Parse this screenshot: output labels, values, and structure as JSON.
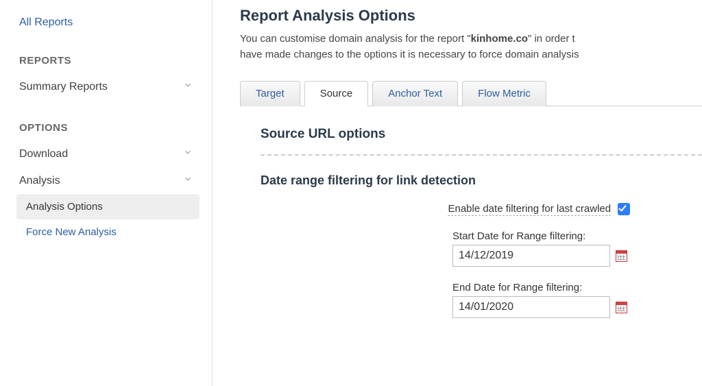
{
  "sidebar": {
    "all_reports": "All Reports",
    "reports_header": "REPORTS",
    "summary_reports": "Summary Reports",
    "options_header": "OPTIONS",
    "download": "Download",
    "analysis": "Analysis",
    "analysis_options": "Analysis Options",
    "force_new_analysis": "Force New Analysis"
  },
  "main": {
    "title": "Report Analysis Options",
    "intro_prefix": "You can customise domain analysis for the report \"",
    "domain": "kinhome.co",
    "intro_mid": "\" in order t",
    "intro_line2": "have made changes to the options it is necessary to force domain analysis"
  },
  "tabs": {
    "target": "Target",
    "source": "Source",
    "anchor": "Anchor Text",
    "flow": "Flow Metric"
  },
  "panel": {
    "source_url_heading": "Source URL options",
    "date_range_heading": "Date range filtering for link detection",
    "enable_label": "Enable date filtering for last crawled",
    "enable_checked": true,
    "start_date_label": "Start Date for Range filtering:",
    "start_date_value": "14/12/2019",
    "end_date_label": "End Date for Range filtering:",
    "end_date_value": "14/01/2020"
  }
}
